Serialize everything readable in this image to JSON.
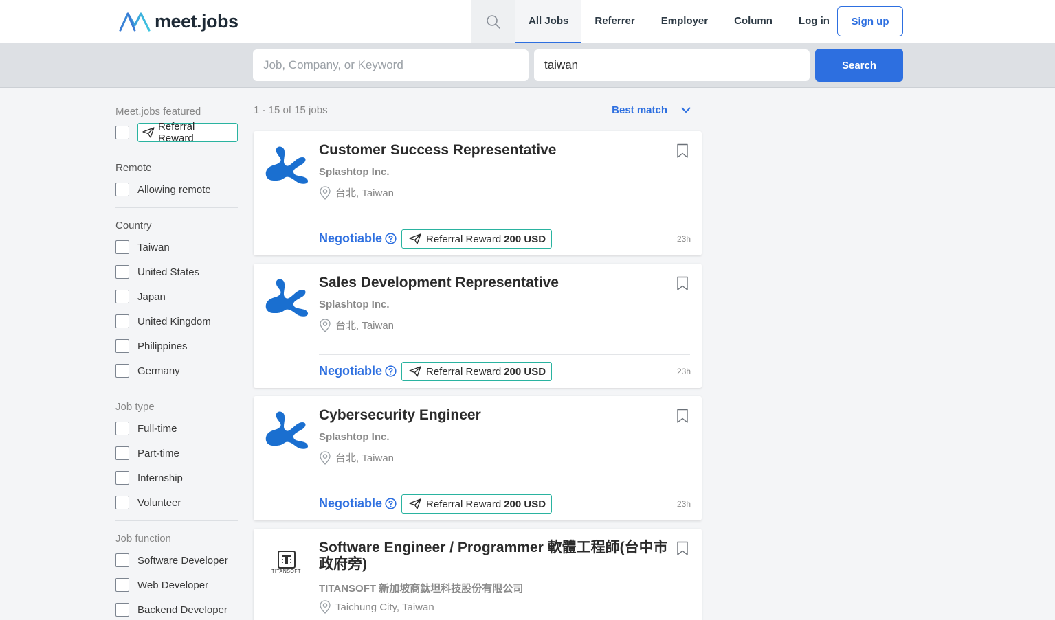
{
  "header": {
    "logo_text": "meet.jobs",
    "nav": [
      "All Jobs",
      "Referrer",
      "Employer",
      "Column",
      "Log in"
    ],
    "signup": "Sign up"
  },
  "search": {
    "keyword_placeholder": "Job, Company, or Keyword",
    "location_value": "taiwan",
    "button": "Search"
  },
  "sidebar": {
    "featured_title": "Meet.jobs featured",
    "featured_tag": "Referral Reward",
    "remote_title": "Remote",
    "remote_options": [
      "Allowing remote"
    ],
    "country_title": "Country",
    "countries": [
      "Taiwan",
      "United States",
      "Japan",
      "United Kingdom",
      "Philippines",
      "Germany"
    ],
    "jobtype_title": "Job type",
    "jobtypes": [
      "Full-time",
      "Part-time",
      "Internship",
      "Volunteer"
    ],
    "jobfunction_title": "Job function",
    "jobfunctions": [
      "Software Developer",
      "Web Developer",
      "Backend Developer"
    ]
  },
  "results": {
    "count": "1 - 15 of 15 jobs",
    "sort": "Best match"
  },
  "jobs": [
    {
      "title": "Customer Success Representative",
      "company": "Splashtop Inc.",
      "location": "台北, Taiwan",
      "salary": "Negotiable",
      "reward_label": "Referral Reward",
      "reward_amount": "200 USD",
      "time": "23h"
    },
    {
      "title": "Sales Development Representative",
      "company": "Splashtop Inc.",
      "location": "台北, Taiwan",
      "salary": "Negotiable",
      "reward_label": "Referral Reward",
      "reward_amount": "200 USD",
      "time": "23h"
    },
    {
      "title": "Cybersecurity Engineer",
      "company": "Splashtop Inc.",
      "location": "台北, Taiwan",
      "salary": "Negotiable",
      "reward_label": "Referral Reward",
      "reward_amount": "200 USD",
      "time": "23h"
    },
    {
      "title": "Software Engineer / Programmer 軟體工程師(台中市政府旁)",
      "company": "TITANSOFT 新加坡商鈦坦科技股份有限公司",
      "location": "Taichung City, Taiwan",
      "logo_text": "TITANSOFT"
    }
  ],
  "colors": {
    "accent": "#2d6fe0",
    "reward_border": "#2ab3a0",
    "splashtop_blue": "#1a6fd0"
  }
}
